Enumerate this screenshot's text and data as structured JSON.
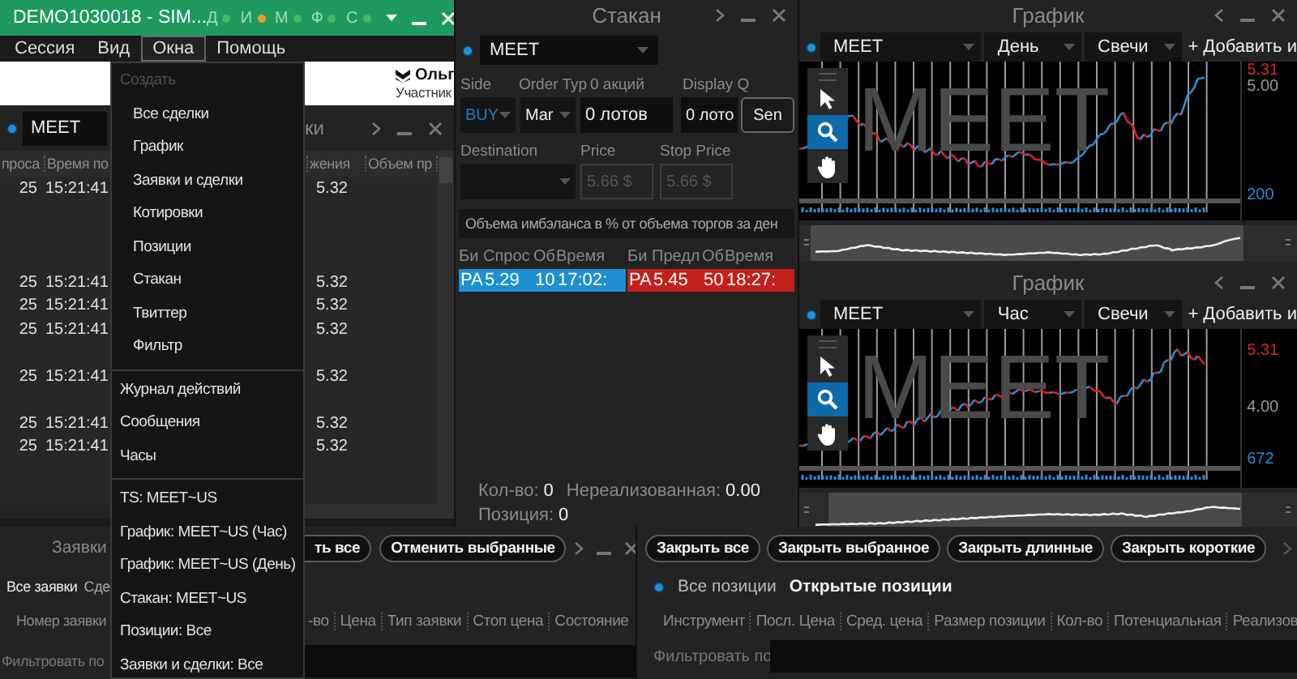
{
  "title_bar": {
    "title": "DEMO1030018 - SIM...",
    "indicators": [
      {
        "label": "Д",
        "color": "#3fbf5a"
      },
      {
        "label": "И",
        "color": "#f0a020"
      },
      {
        "label": "М",
        "color": "#3fbf5a"
      },
      {
        "label": "Ф",
        "color": "#3fbf5a"
      },
      {
        "label": "С",
        "color": "#3fbf5a"
      }
    ]
  },
  "menu_bar": [
    {
      "label": "Сессия",
      "selected": false
    },
    {
      "label": "Вид",
      "selected": false
    },
    {
      "label": "Окна",
      "selected": true
    },
    {
      "label": "Помощь",
      "selected": false
    }
  ],
  "background_page": {
    "heading": "Ольг",
    "subtitle": "Участник"
  },
  "time_and_sales": {
    "symbol": "MEET",
    "title": "ки",
    "columns": [
      "проса",
      "Время по",
      "жения",
      "Объем пр"
    ],
    "rows": [
      {
        "kind": "trade",
        "size": "25",
        "time": "15:21:41",
        "price": "5.32"
      },
      {
        "kind": "empty"
      },
      {
        "kind": "empty"
      },
      {
        "kind": "empty"
      },
      {
        "kind": "trade",
        "size": "25",
        "time": "15:21:41",
        "price": "5.32"
      },
      {
        "kind": "trade",
        "size": "25",
        "time": "15:21:41",
        "price": "5.32"
      },
      {
        "kind": "trade",
        "size": "25",
        "time": "15:21:41",
        "price": "5.32"
      },
      {
        "kind": "empty"
      },
      {
        "kind": "trade",
        "size": "25",
        "time": "15:21:41",
        "price": "5.32"
      },
      {
        "kind": "empty"
      },
      {
        "kind": "trade",
        "size": "25",
        "time": "15:21:41",
        "price": "5.32"
      },
      {
        "kind": "trade",
        "size": "25",
        "time": "15:21:41",
        "price": "5.32"
      }
    ]
  },
  "order_book": {
    "title": "Стакан",
    "symbol": "MEET",
    "row1_labels": [
      "Side",
      "Order Typ",
      "0 акций",
      "Display Q"
    ],
    "side": "BUY",
    "order_type": "Mar",
    "quantity": "0 лотов",
    "display_quantity": "0 лото",
    "send_button": "Sen",
    "row2_labels": [
      "Destination",
      "Price",
      "Stop Price"
    ],
    "price": {
      "value": "5.66 $",
      "disabled": true
    },
    "stop_price": {
      "value": "5.66 $",
      "disabled": true
    },
    "banner": "Объема имбэланса в % от объема торгов за ден",
    "columns": [
      "Би",
      "Спрос",
      "Об",
      "Время",
      "Би",
      "Предл",
      "Об",
      "Время"
    ],
    "bid": [
      "PA",
      "5.29",
      "10",
      "17:02:"
    ],
    "ask": [
      "PA",
      "5.45",
      "50",
      "18:27:"
    ],
    "footer": [
      [
        {
          "label": "Кол-во:",
          "value": "0"
        },
        {
          "label": "Нереализованная:",
          "value": "0.00"
        }
      ],
      [
        {
          "label": "Позиция:",
          "value": "0"
        }
      ]
    ]
  },
  "charts": [
    {
      "title": "График",
      "symbol": "MEET",
      "interval": "День",
      "style": "Свечи",
      "add_button": "+ Добавить и",
      "watermark": "MEET",
      "tools": [
        {
          "kind": "pointer",
          "selected": false
        },
        {
          "kind": "zoom",
          "selected": true
        },
        {
          "kind": "pan",
          "selected": false
        }
      ],
      "axis_labels": [
        {
          "kind": "last",
          "text": "5.31"
        },
        {
          "kind": "tick",
          "text": "5.00"
        },
        {
          "kind": "volume",
          "text": "200"
        }
      ]
    },
    {
      "title": "График",
      "symbol": "MEET",
      "interval": "Час",
      "style": "Свечи",
      "add_button": "+ Добавить и",
      "watermark": "MEET",
      "tools": [
        {
          "kind": "pointer",
          "selected": false
        },
        {
          "kind": "zoom",
          "selected": true
        },
        {
          "kind": "pan",
          "selected": false
        }
      ],
      "axis_labels": [
        {
          "kind": "last",
          "text": "5.31"
        },
        {
          "kind": "tick",
          "text": "4.00"
        },
        {
          "kind": "volume",
          "text": "672"
        }
      ]
    }
  ],
  "orders": {
    "title": "Заявки",
    "buttons": [
      "ть все",
      "Отменить выбранные"
    ],
    "tabs": [
      {
        "label": "Все заявки",
        "selected": true
      },
      {
        "label": "Сде",
        "selected": false
      }
    ],
    "first_column": "Номер заявки",
    "columns": [
      "-во",
      "Цена",
      "Тип заявки",
      "Стоп цена",
      "Состояние"
    ],
    "filter_label": "Фильтровать по"
  },
  "positions": {
    "buttons": [
      "Закрыть все",
      "Закрыть выбранное",
      "Закрыть длинные",
      "Закрыть короткие"
    ],
    "tabs": [
      {
        "label": "Все позиции",
        "selected": false
      },
      {
        "label": "Открытые позиции",
        "selected": true
      }
    ],
    "columns": [
      "Инструмент",
      "Посл. Цена",
      "Сред. цена",
      "Размер позиции",
      "Кол-во",
      "Потенциальная",
      "Реализов"
    ],
    "filter_label": "Фильтровать по"
  },
  "windows_menu": {
    "groups": [
      {
        "items": [
          {
            "label": "Создать",
            "disabled": true
          },
          {
            "label": "Все сделки",
            "disabled": false
          },
          {
            "label": "График",
            "disabled": false
          },
          {
            "label": "Заявки и сделки",
            "disabled": false
          },
          {
            "label": "Котировки",
            "disabled": false
          },
          {
            "label": "Позиции",
            "disabled": false
          },
          {
            "label": "Стакан",
            "disabled": false
          },
          {
            "label": "Твиттер",
            "disabled": false
          },
          {
            "label": "Фильтр",
            "disabled": false
          }
        ]
      },
      {
        "items": [
          {
            "label": "Журнал действий",
            "disabled": false
          },
          {
            "label": "Сообщения",
            "disabled": false
          },
          {
            "label": "Часы",
            "disabled": false
          }
        ]
      },
      {
        "items": [
          {
            "label": "TS: MEET~US",
            "disabled": false
          },
          {
            "label": "График: MEET~US (Час)",
            "disabled": false
          },
          {
            "label": "График: MEET~US (День)",
            "disabled": false
          },
          {
            "label": "Стакан: MEET~US",
            "disabled": false
          },
          {
            "label": "Позиции: Все",
            "disabled": false
          },
          {
            "label": "Заявки и сделки: Все",
            "disabled": false
          }
        ]
      }
    ]
  }
}
